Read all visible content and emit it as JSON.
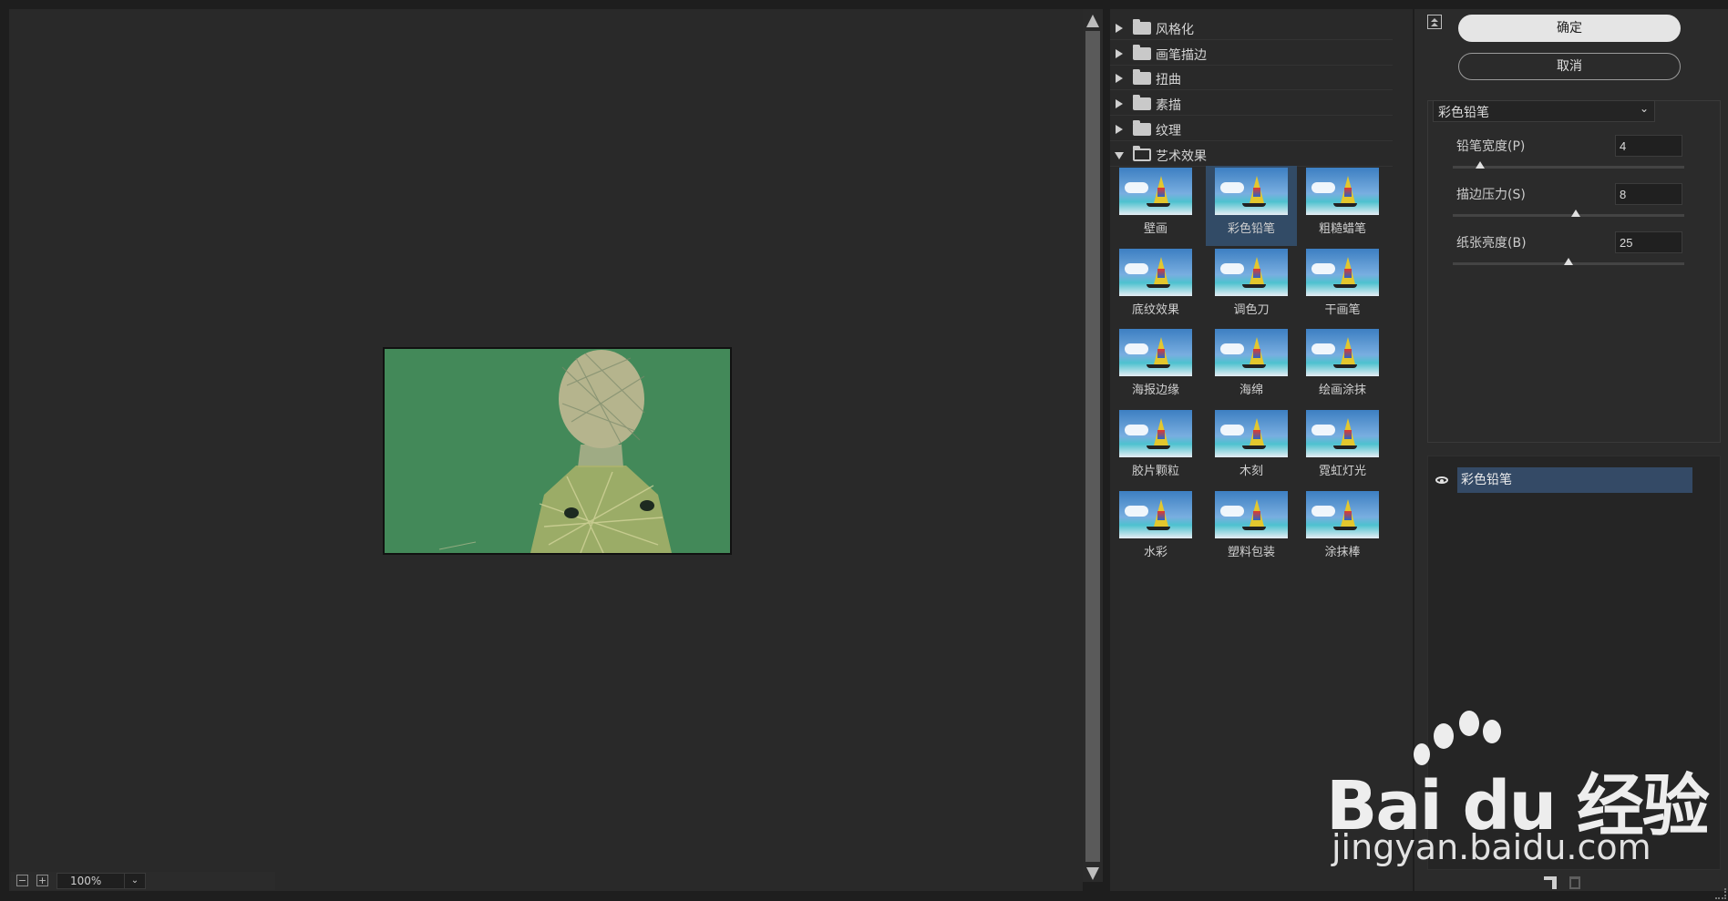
{
  "zoom": {
    "value": "100%"
  },
  "categories": [
    {
      "label": "风格化",
      "expanded": false
    },
    {
      "label": "画笔描边",
      "expanded": false
    },
    {
      "label": "扭曲",
      "expanded": false
    },
    {
      "label": "素描",
      "expanded": false
    },
    {
      "label": "纹理",
      "expanded": false
    },
    {
      "label": "艺术效果",
      "expanded": true
    }
  ],
  "filters": [
    {
      "label": "壁画",
      "selected": false
    },
    {
      "label": "彩色铅笔",
      "selected": true
    },
    {
      "label": "粗糙蜡笔",
      "selected": false
    },
    {
      "label": "底纹效果",
      "selected": false
    },
    {
      "label": "调色刀",
      "selected": false
    },
    {
      "label": "干画笔",
      "selected": false
    },
    {
      "label": "海报边缘",
      "selected": false
    },
    {
      "label": "海绵",
      "selected": false
    },
    {
      "label": "绘画涂抹",
      "selected": false
    },
    {
      "label": "胶片颗粒",
      "selected": false
    },
    {
      "label": "木刻",
      "selected": false
    },
    {
      "label": "霓虹灯光",
      "selected": false
    },
    {
      "label": "水彩",
      "selected": false
    },
    {
      "label": "塑料包装",
      "selected": false
    },
    {
      "label": "涂抹棒",
      "selected": false
    }
  ],
  "buttons": {
    "ok": "确定",
    "cancel": "取消"
  },
  "settings": {
    "filter_name": "彩色铅笔",
    "params": [
      {
        "label": "铅笔宽度(P)",
        "value": "4",
        "slider_fraction": 0.12
      },
      {
        "label": "描边压力(S)",
        "value": "8",
        "slider_fraction": 0.53
      },
      {
        "label": "纸张亮度(B)",
        "value": "25",
        "slider_fraction": 0.5
      }
    ]
  },
  "layers": [
    {
      "name": "彩色铅笔",
      "visible": true
    }
  ],
  "watermark": {
    "brand": "Bai du 经验",
    "url": "jingyan.baidu.com"
  },
  "colors": {
    "accent_selected": "#344a66",
    "preview_bg": "#438959"
  }
}
